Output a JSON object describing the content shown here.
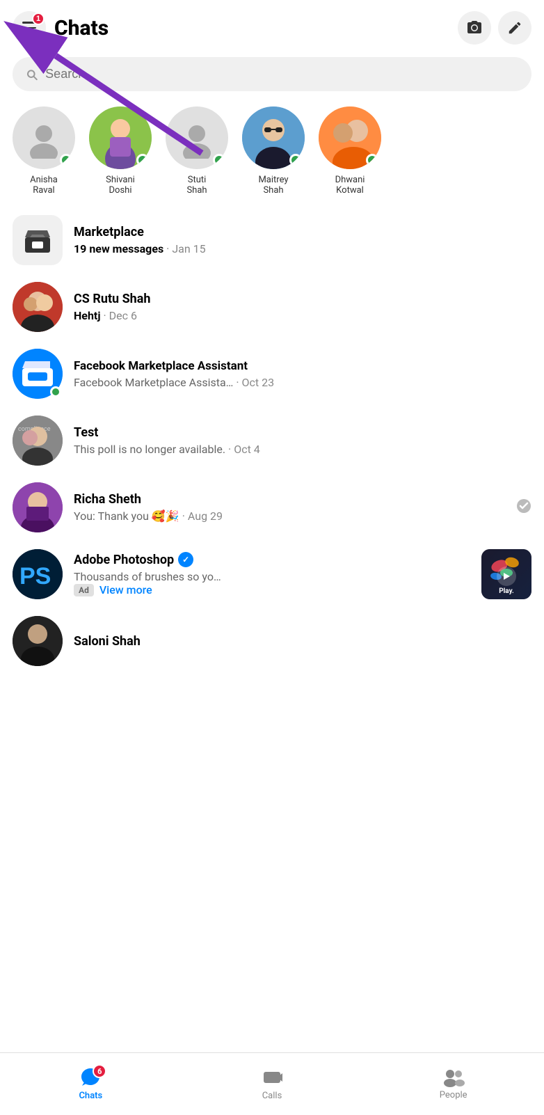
{
  "header": {
    "title": "Chats",
    "menu_badge": "1",
    "camera_label": "camera",
    "edit_label": "edit"
  },
  "search": {
    "placeholder": "Search"
  },
  "stories": [
    {
      "id": "anisha",
      "name": "Anisha\nRaval",
      "hasPhoto": false,
      "online": true
    },
    {
      "id": "shivani",
      "name": "Shivani\nDoshi",
      "hasPhoto": true,
      "online": true
    },
    {
      "id": "stuti",
      "name": "Stuti\nShah",
      "hasPhoto": false,
      "online": true
    },
    {
      "id": "maitrey",
      "name": "Maitrey\nShah",
      "hasPhoto": true,
      "online": true
    },
    {
      "id": "dhwani",
      "name": "Dhwani\nKotwal",
      "hasPhoto": true,
      "online": true
    }
  ],
  "chats": [
    {
      "id": "marketplace",
      "name": "Marketplace",
      "preview": "19 new messages",
      "date": "Jan 15",
      "bold": true,
      "type": "marketplace"
    },
    {
      "id": "cs-rutu",
      "name": "CS Rutu Shah",
      "preview": "Hehtj",
      "date": "Dec 6",
      "bold": true,
      "type": "person"
    },
    {
      "id": "fb-marketplace-assistant",
      "name": "Facebook Marketplace Assistant",
      "preview": "Facebook Marketplace Assista…",
      "date": "Oct 23",
      "bold": false,
      "online": true,
      "type": "bot"
    },
    {
      "id": "test",
      "name": "Test",
      "preview": "This poll is no longer available.",
      "date": "Oct 4",
      "bold": false,
      "type": "person"
    },
    {
      "id": "richa-sheth",
      "name": "Richa Sheth",
      "preview": "You: Thank you 🥰🎉",
      "date": "Aug 29",
      "bold": false,
      "readCheck": true,
      "type": "person"
    },
    {
      "id": "adobe-photoshop",
      "name": "Adobe Photoshop",
      "verified": true,
      "preview": "Thousands of brushes so yo…",
      "ad": true,
      "viewMore": "View more",
      "type": "ad",
      "thumbnail": true
    },
    {
      "id": "saloni-shah",
      "name": "Saloni Shah",
      "preview": "",
      "date": "",
      "bold": false,
      "type": "person"
    }
  ],
  "bottomNav": {
    "items": [
      {
        "id": "chats",
        "label": "Chats",
        "active": true,
        "badge": "6"
      },
      {
        "id": "calls",
        "label": "Calls",
        "active": false
      },
      {
        "id": "people",
        "label": "People",
        "active": false
      }
    ]
  },
  "arrow": {
    "visible": true
  }
}
